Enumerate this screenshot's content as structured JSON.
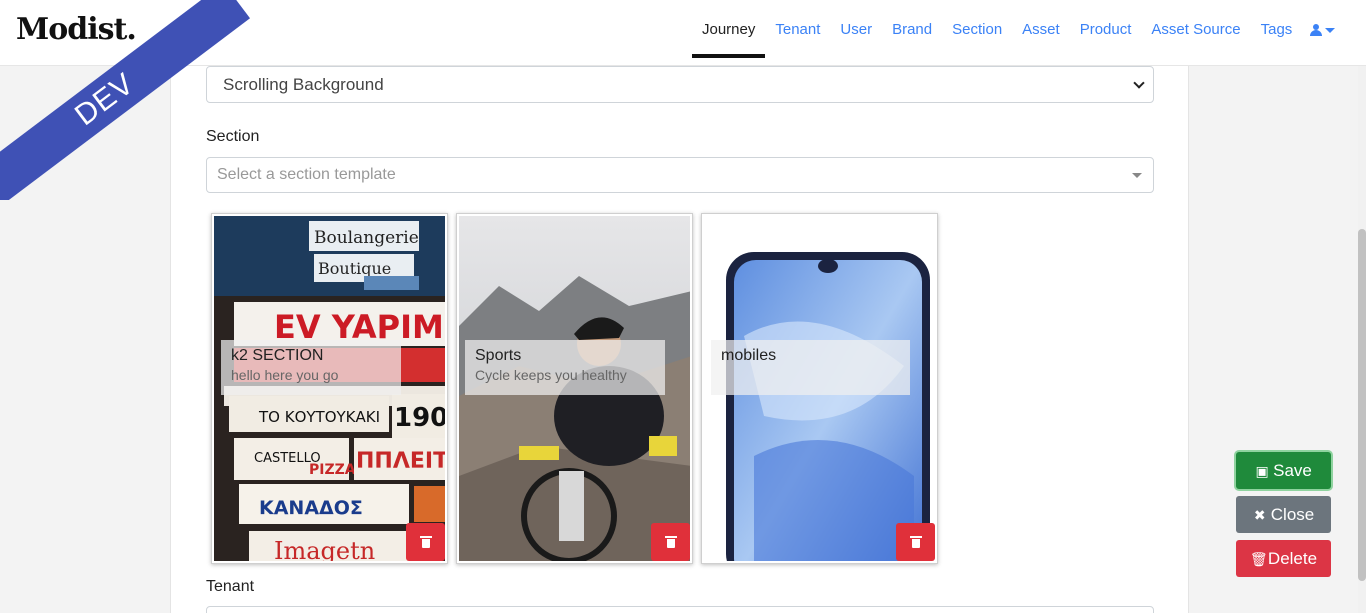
{
  "brand": "Modist.",
  "ribbon": "DEV",
  "nav": {
    "items": [
      {
        "label": "Journey",
        "active": true
      },
      {
        "label": "Tenant",
        "active": false
      },
      {
        "label": "User",
        "active": false
      },
      {
        "label": "Brand",
        "active": false
      },
      {
        "label": "Section",
        "active": false
      },
      {
        "label": "Asset",
        "active": false
      },
      {
        "label": "Product",
        "active": false
      },
      {
        "label": "Asset Source",
        "active": false
      },
      {
        "label": "Tags",
        "active": false
      }
    ],
    "user_icon": "user-icon"
  },
  "form": {
    "type_value": "Scrolling Background",
    "section_label": "Section",
    "section_placeholder": "Select a section template",
    "tenant_label": "Tenant"
  },
  "cards": [
    {
      "title": "k2 SECTION",
      "subtitle": "hello here you go",
      "image": "street signs photo"
    },
    {
      "title": "Sports",
      "subtitle": "Cycle keeps you healthy",
      "image": "cyclist photo"
    },
    {
      "title": "mobiles",
      "subtitle": "",
      "image": "smartphone photo"
    }
  ],
  "actions": {
    "save": "Save",
    "close": "Close",
    "delete": "Delete"
  },
  "colors": {
    "nav_link": "#3b82f6",
    "ribbon": "#3f51b5",
    "save": "#1f8a3b",
    "close": "#6c757d",
    "delete": "#dc3545"
  }
}
